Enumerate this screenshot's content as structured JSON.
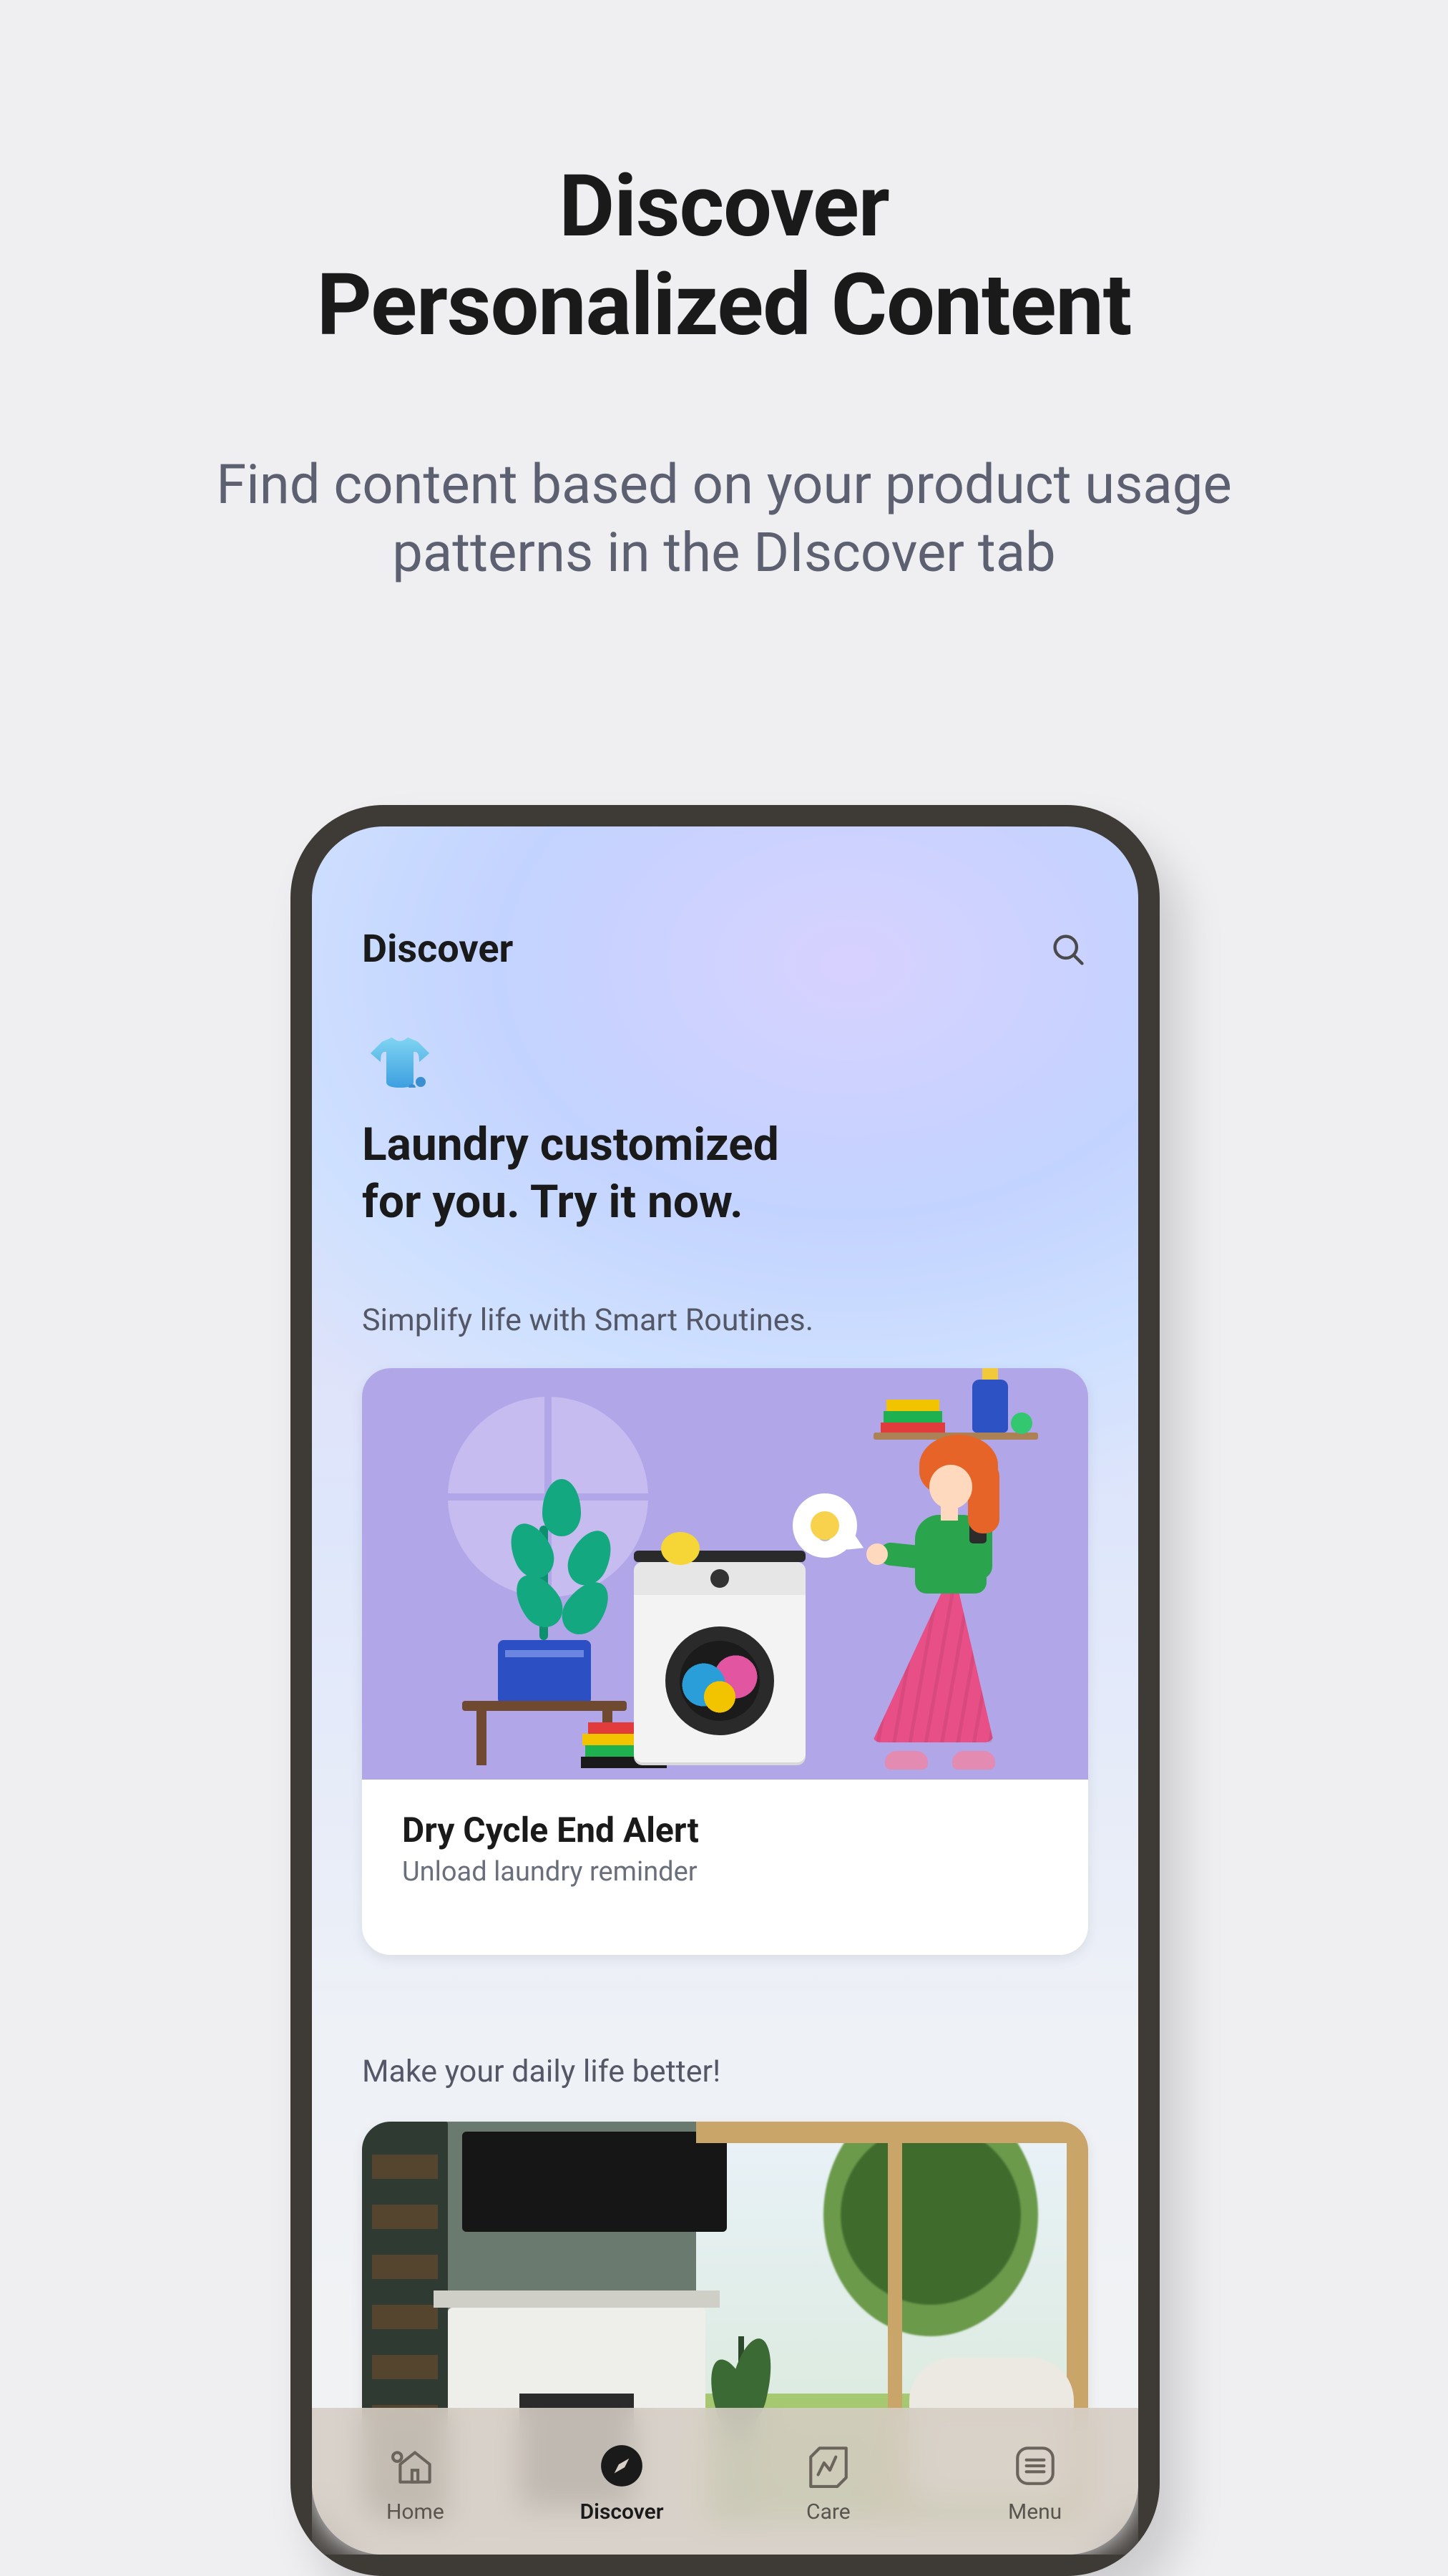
{
  "hero": {
    "title_line1": "Discover",
    "title_line2": "Personalized Content",
    "subtitle_line1": "Find content based on your product usage",
    "subtitle_line2": "patterns in the DIscover tab"
  },
  "app": {
    "header": {
      "title": "Discover"
    },
    "promo": {
      "headline_line1": "Laundry customized",
      "headline_line2": "for you. Try it now."
    },
    "sections": {
      "routines_label": "Simplify life with Smart Routines.",
      "daily_label": "Make your daily life better!"
    },
    "card_routines": {
      "title": "Dry Cycle End Alert",
      "subtitle": "Unload laundry reminder"
    },
    "nav": {
      "home": "Home",
      "discover": "Discover",
      "care": "Care",
      "menu": "Menu",
      "active": "discover"
    }
  }
}
